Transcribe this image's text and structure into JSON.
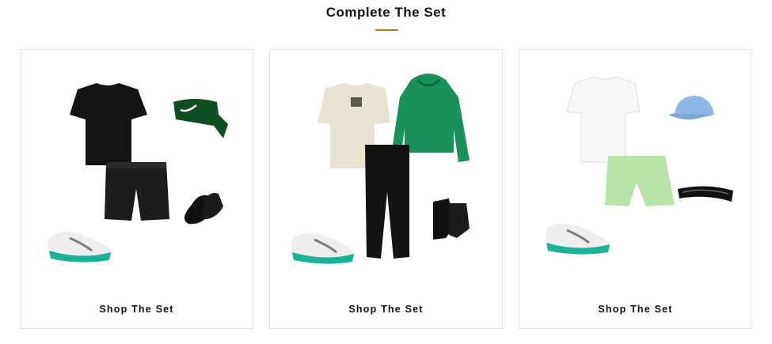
{
  "section": {
    "title": "Complete The Set",
    "accent_color": "#b87a2b"
  },
  "cards": [
    {
      "cta": "Shop The Set",
      "items": [
        "black-tee",
        "dark-green-head-tie",
        "black-shorts",
        "black-no-show-socks",
        "white-teal-running-shoe"
      ]
    },
    {
      "cta": "Shop The Set",
      "items": [
        "cream-graphic-tee",
        "green-hoodie",
        "black-joggers",
        "black-crew-socks",
        "white-teal-running-shoe"
      ]
    },
    {
      "cta": "Shop The Set",
      "items": [
        "white-tee",
        "light-blue-cap",
        "lime-shorts",
        "black-running-belt",
        "white-teal-running-shoe"
      ]
    }
  ]
}
